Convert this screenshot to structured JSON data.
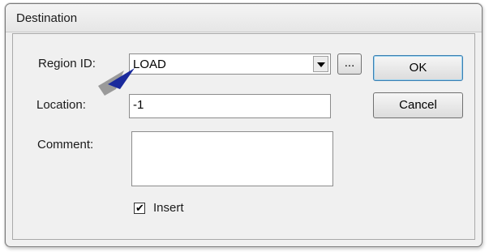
{
  "window": {
    "title": "Destination"
  },
  "form": {
    "region_label": "Region ID:",
    "region_value": "LOAD",
    "browse_label": "...",
    "location_label": "Location:",
    "location_value": "-1",
    "comment_label": "Comment:",
    "comment_value": "",
    "insert_label": "Insert",
    "insert_checked": true
  },
  "buttons": {
    "ok": "OK",
    "cancel": "Cancel"
  },
  "annotation": {
    "icon": "blue-pointer-arrow",
    "color": "#1a2a9c"
  }
}
